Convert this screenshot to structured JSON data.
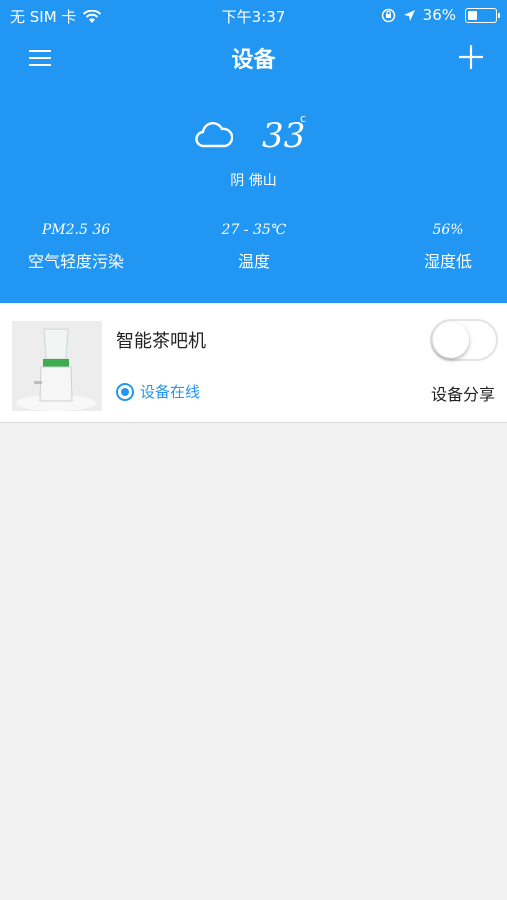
{
  "status_bar": {
    "carrier": "无 SIM 卡",
    "time": "下午3:37",
    "battery_percent": "36%",
    "battery_level": 0.36
  },
  "nav": {
    "title": "设备",
    "menu_icon": "hamburger-menu-icon",
    "add_icon": "plus-icon"
  },
  "weather": {
    "icon": "cloud-icon",
    "temperature": "33",
    "temperature_unit": "c",
    "location": "阴  佛山"
  },
  "stats": {
    "pm": {
      "value": "PM2.5 36",
      "label": "空气轻度污染"
    },
    "temperature": {
      "value": "27 - 35℃",
      "label": "温度"
    },
    "humidity": {
      "value": "56%",
      "label": "湿度低"
    }
  },
  "device": {
    "name": "智能茶吧机",
    "online_status": "设备在线",
    "share_label": "设备分享",
    "power_on": false
  },
  "colors": {
    "primary": "#2196f3",
    "background": "#f2f2f2"
  }
}
